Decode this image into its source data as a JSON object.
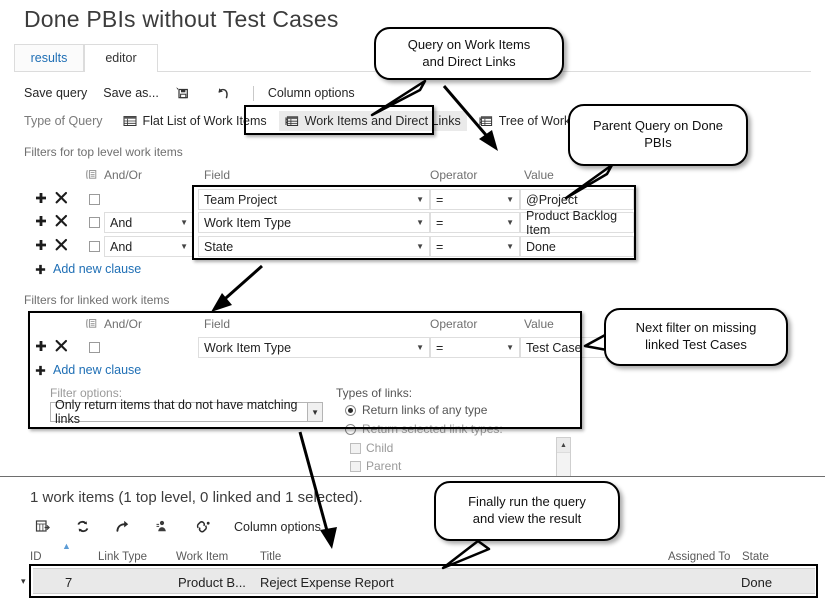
{
  "page_title": "Done PBIs without Test Cases",
  "tabs": [
    {
      "label": "results",
      "active": false
    },
    {
      "label": "editor",
      "active": true
    }
  ],
  "command_bar": {
    "save_query": "Save query",
    "save_as": "Save as...",
    "save_icon": "save-copy-icon",
    "undo_icon": "undo-icon",
    "column_options": "Column options"
  },
  "type_of_query": {
    "label": "Type of Query",
    "options": [
      {
        "label": "Flat List of Work Items",
        "icon": "flat-list-icon",
        "selected": false
      },
      {
        "label": "Work Items and Direct Links",
        "icon": "direct-links-icon",
        "selected": true
      },
      {
        "label": "Tree of Work Items",
        "icon": "tree-icon",
        "selected": false
      }
    ]
  },
  "top_level_filters": {
    "section_label": "Filters for top level work items",
    "headers": {
      "group": "group-icon",
      "andor": "And/Or",
      "field": "Field",
      "operator": "Operator",
      "value": "Value"
    },
    "rows": [
      {
        "andor": "",
        "field": "Team Project",
        "operator": "=",
        "value": "@Project"
      },
      {
        "andor": "And",
        "field": "Work Item Type",
        "operator": "=",
        "value": "Product Backlog Item"
      },
      {
        "andor": "And",
        "field": "State",
        "operator": "=",
        "value": "Done"
      }
    ],
    "add_new_clause": "Add new clause"
  },
  "linked_filters": {
    "section_label": "Filters for linked work items",
    "headers": {
      "group": "group-icon",
      "andor": "And/Or",
      "field": "Field",
      "operator": "Operator",
      "value": "Value"
    },
    "rows": [
      {
        "andor": "",
        "field": "Work Item Type",
        "operator": "=",
        "value": "Test Case"
      }
    ],
    "add_new_clause": "Add new clause"
  },
  "filter_options": {
    "label": "Filter options:",
    "selected": "Only return items that do not have matching links"
  },
  "types_of_links": {
    "label": "Types of links:",
    "radio_any": "Return links of any type",
    "radio_selected": "Return selected link types:",
    "link_types": [
      "Child",
      "Parent"
    ]
  },
  "results": {
    "count_text": "1 work items (1 top level, 0 linked and 1 selected).",
    "toolbar": {
      "icons": [
        "open-in-excel-icon",
        "refresh-icon",
        "share-icon",
        "open-in-project-icon",
        "link-icon"
      ],
      "column_options": "Column options"
    },
    "columns": [
      "ID",
      "Link Type",
      "Work Item",
      "Title",
      "Assigned To",
      "State"
    ],
    "rows": [
      {
        "id": "7",
        "link_type": "",
        "work_item": "Product B...",
        "title": "Reject Expense Report",
        "assigned_to": "",
        "state": "Done"
      }
    ]
  },
  "callouts": [
    {
      "id": "callout-direct-links",
      "text": "Query on Work Items\nand Direct Links"
    },
    {
      "id": "callout-parent-query",
      "text": "Parent Query on Done\nPBIs"
    },
    {
      "id": "callout-next-filter",
      "text": "Next filter on missing\nlinked Test Cases"
    },
    {
      "id": "callout-run-query",
      "text": "Finally run the query\nand view the result"
    }
  ],
  "colors": {
    "link": "#1f6fb5",
    "title": "#3c3c3c",
    "annotation": "#000000",
    "row_selected_bg": "#e9e9e9"
  }
}
